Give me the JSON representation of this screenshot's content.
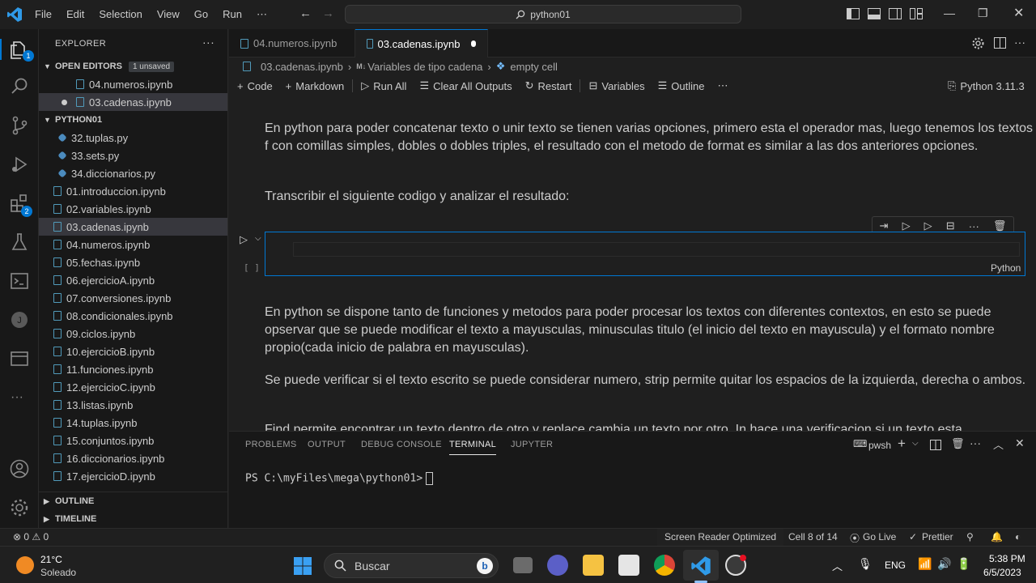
{
  "titlebar": {
    "menu": [
      "File",
      "Edit",
      "Selection",
      "View",
      "Go",
      "Run",
      "⋯"
    ],
    "search": "python01"
  },
  "activity": {
    "explorer_badge": "1",
    "extensions_badge": "2"
  },
  "sidebar": {
    "header": "EXPLORER",
    "open_editors_label": "OPEN EDITORS",
    "unsaved_badge": "1 unsaved",
    "open_editors": [
      "04.numeros.ipynb",
      "03.cadenas.ipynb"
    ],
    "folder_label": "PYTHON01",
    "files": [
      "32.tuplas.py",
      "33.sets.py",
      "34.diccionarios.py",
      "01.introduccion.ipynb",
      "02.variables.ipynb",
      "03.cadenas.ipynb",
      "04.numeros.ipynb",
      "05.fechas.ipynb",
      "06.ejercicioA.ipynb",
      "07.conversiones.ipynb",
      "08.condicionales.ipynb",
      "09.ciclos.ipynb",
      "10.ejercicioB.ipynb",
      "11.funciones.ipynb",
      "12.ejercicioC.ipynb",
      "13.listas.ipynb",
      "14.tuplas.ipynb",
      "15.conjuntos.ipynb",
      "16.diccionarios.ipynb",
      "17.ejercicioD.ipynb"
    ],
    "outline_label": "OUTLINE",
    "timeline_label": "TIMELINE"
  },
  "tabs": [
    {
      "label": "04.numeros.ipynb"
    },
    {
      "label": "03.cadenas.ipynb"
    }
  ],
  "breadcrumb": {
    "file": "03.cadenas.ipynb",
    "section_prefix": "M↓",
    "section": "Variables de tipo cadena",
    "cell": "empty cell"
  },
  "toolbar": {
    "code": "Code",
    "markdown": "Markdown",
    "run_all": "Run All",
    "clear_outputs": "Clear All Outputs",
    "restart": "Restart",
    "variables": "Variables",
    "outline": "Outline",
    "more": "⋯",
    "kernel": "Python 3.11.3"
  },
  "notebook": {
    "para1": "En python para poder concatenar texto o unir texto se tienen varias opciones, primero esta el operador mas, luego tenemos los textos f con comillas simples, dobles o dobles triples, el resultado con el metodo de format es similar a las dos anteriores opciones.",
    "para2": "Transcribir el siguiente codigo y analizar el resultado:",
    "cell_exec": "[ ]",
    "cell_lang": "Python",
    "para3": "En python se dispone tanto de funciones y metodos para poder procesar los textos con diferentes contextos, en esto se puede opservar que se puede modificar el texto a mayusculas, minusculas titulo (el inicio del texto en mayuscula) y el formato nombre propio(cada inicio de palabra en mayusculas).",
    "para4": "Se puede verificar si el texto escrito se puede considerar numero, strip permite quitar los espacios de la izquierda, derecha o ambos.",
    "para5": "Find permite encontrar un texto dentro de otro y replace cambia un texto por otro. In hace una verificacion si un texto esta"
  },
  "panel": {
    "tabs": [
      "PROBLEMS",
      "OUTPUT",
      "DEBUG CONSOLE",
      "TERMINAL",
      "JUPYTER"
    ],
    "shell": "pwsh",
    "prompt": "PS C:\\myFiles\\mega\\python01>"
  },
  "statusbar": {
    "problems": "⊗ 0 ⚠ 0",
    "screen_reader": "Screen Reader Optimized",
    "cell": "Cell 8 of 14",
    "go_live": "Go Live",
    "prettier": "Prettier"
  },
  "taskbar": {
    "temp": "21°C",
    "weather": "Soleado",
    "search": "Buscar",
    "lang": "ENG",
    "time": "5:38 PM",
    "date": "6/5/2023"
  },
  "colors": {
    "accent": "#0078d4",
    "statusbar": "#1f1f1f",
    "background": "#1f1f1f"
  }
}
